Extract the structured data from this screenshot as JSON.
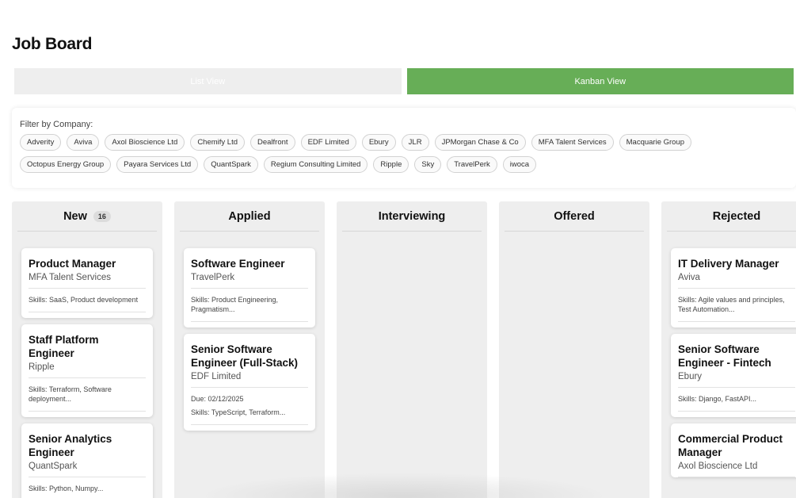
{
  "page": {
    "title": "Job Board"
  },
  "view_toggle": {
    "list_label": "List View",
    "kanban_label": "Kanban View",
    "active": "kanban"
  },
  "filter": {
    "label": "Filter by Company:",
    "companies": [
      "Adverity",
      "Aviva",
      "Axol Bioscience Ltd",
      "Chemify Ltd",
      "Dealfront",
      "EDF Limited",
      "Ebury",
      "JLR",
      "JPMorgan Chase & Co",
      "MFA Talent Services",
      "Macquarie Group",
      "Octopus Energy Group",
      "Payara Services Ltd",
      "QuantSpark",
      "Regium Consulting Limited",
      "Ripple",
      "Sky",
      "TravelPerk",
      "iwoca"
    ]
  },
  "columns": [
    {
      "title": "New",
      "count": "16",
      "cards": [
        {
          "title": "Product Manager",
          "company": "MFA Talent Services",
          "due": "",
          "skills": "Skills: SaaS, Product development"
        },
        {
          "title": "Staff Platform Engineer",
          "company": "Ripple",
          "due": "",
          "skills": "Skills: Terraform, Software deployment..."
        },
        {
          "title": "Senior Analytics Engineer",
          "company": "QuantSpark",
          "due": "",
          "skills": "Skills: Python, Numpy..."
        }
      ]
    },
    {
      "title": "Applied",
      "count": "",
      "cards": [
        {
          "title": "Software Engineer",
          "company": "TravelPerk",
          "due": "",
          "skills": "Skills: Product Engineering, Pragmatism..."
        },
        {
          "title": "Senior Software Engineer (Full-Stack)",
          "company": "EDF Limited",
          "due": "Due: 02/12/2025",
          "skills": "Skills: TypeScript, Terraform..."
        }
      ]
    },
    {
      "title": "Interviewing",
      "count": "",
      "cards": []
    },
    {
      "title": "Offered",
      "count": "",
      "cards": []
    },
    {
      "title": "Rejected",
      "count": "",
      "cards": [
        {
          "title": "IT Delivery Manager",
          "company": "Aviva",
          "due": "",
          "skills": "Skills: Agile values and principles, Test Automation..."
        },
        {
          "title": "Senior Software Engineer - Fintech",
          "company": "Ebury",
          "due": "",
          "skills": "Skills: Django, FastAPI..."
        },
        {
          "title": "Commercial Product Manager",
          "company": "Axol Bioscience Ltd",
          "due": "",
          "skills": ""
        }
      ]
    }
  ],
  "colors": {
    "accent": "#67ae57",
    "column_bg": "#eeeeee",
    "inactive_button": "#eeeeee"
  }
}
